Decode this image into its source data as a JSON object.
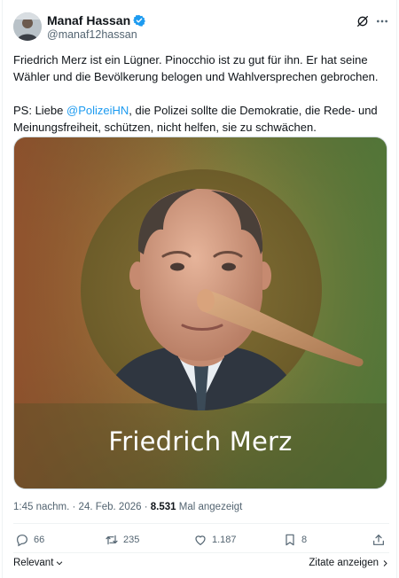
{
  "author": {
    "display_name": "Manaf Hassan",
    "handle": "@manaf12hassan",
    "verified": true
  },
  "tweet": {
    "line1": "Friedrich Merz ist ein Lügner. Pinocchio ist zu gut für ihn. Er hat seine Wähler und die Bevölkerung belogen und Wahlversprechen gebrochen.",
    "line2_prefix": "PS: Liebe ",
    "mention": "@PolizeiHN",
    "line2_suffix": ", die Polizei sollte die Demokratie, die Rede- und Meinungsfreiheit, schützen, nicht helfen, sie zu schwächen."
  },
  "media": {
    "caption": "Friedrich Merz"
  },
  "meta": {
    "time": "1:45 nachm.",
    "separator": "·",
    "date": "24. Feb. 2026",
    "views_count": "8.531",
    "views_label": "Mal angezeigt"
  },
  "actions": {
    "replies": "66",
    "reposts": "235",
    "likes": "1.187",
    "bookmarks": "8"
  },
  "footer": {
    "sort_label": "Relevant",
    "quotes_label": "Zitate anzeigen"
  },
  "icons": {
    "verified": "verified-badge-icon",
    "grok": "grok-icon",
    "more": "more-icon",
    "reply": "reply-icon",
    "repost": "repost-icon",
    "like": "heart-icon",
    "bookmark": "bookmark-icon",
    "share": "share-icon"
  },
  "colors": {
    "accent": "#1d9bf0",
    "text_primary": "#0f1419",
    "text_secondary": "#536471"
  }
}
